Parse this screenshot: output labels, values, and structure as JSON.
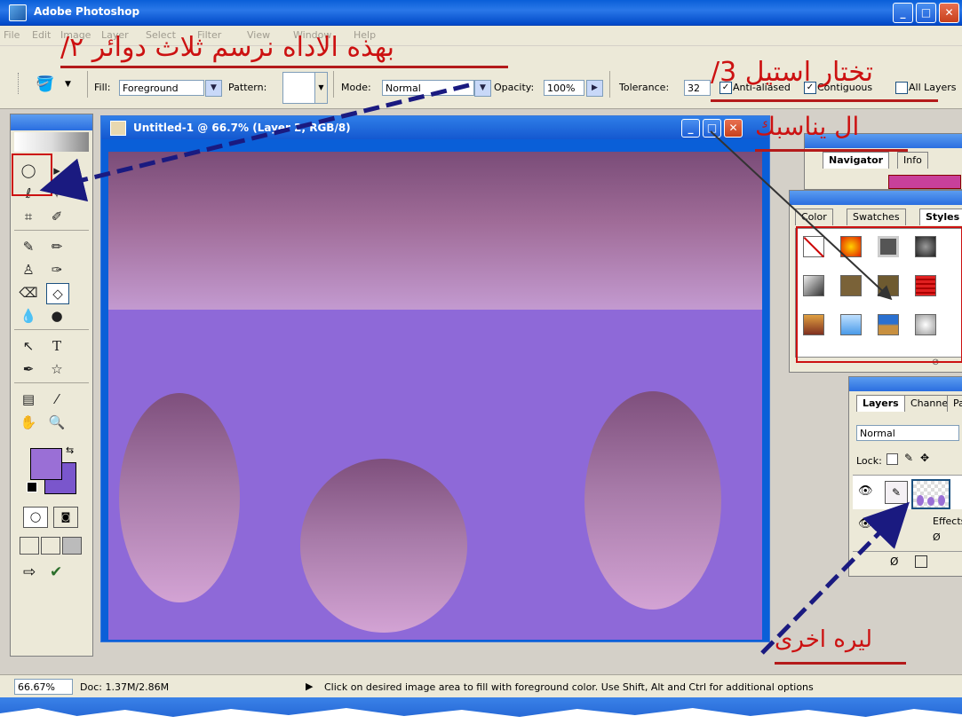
{
  "app": {
    "title": "Adobe Photoshop"
  },
  "menu": [
    "File",
    "Edit",
    "Image",
    "Layer",
    "Select",
    "Filter",
    "View",
    "Window",
    "Help"
  ],
  "options": {
    "fill_label": "Fill:",
    "fill_value": "Foreground",
    "pattern_label": "Pattern:",
    "mode_label": "Mode:",
    "mode_value": "Normal",
    "opacity_label": "Opacity:",
    "opacity_value": "100%",
    "tolerance_label": "Tolerance:",
    "tolerance_value": "32",
    "antialiased_label": "Anti-aliased",
    "contiguous_label": "Contiguous",
    "alllayers_label": "All Layers"
  },
  "document": {
    "title": "Untitled-1 @ 66.7% (Layer 2, RGB/8)"
  },
  "navigator": {
    "tabs": [
      "Navigator",
      "Info"
    ]
  },
  "styles_panel": {
    "tabs": [
      "Color",
      "Swatches",
      "Styles"
    ]
  },
  "layers_panel": {
    "tabs": [
      "Layers",
      "Channels",
      "Paths"
    ],
    "blend_mode": "Normal",
    "lock_label": "Lock:",
    "effects_label": "Effects"
  },
  "status": {
    "zoom": "66.67%",
    "doc": "Doc: 1.37M/2.86M",
    "hint": "Click on desired image area to fill with foreground color.  Use Shift, Alt and Ctrl for additional options"
  },
  "annotations": {
    "step1": "بهذه الاداه نرسم ثلاث دوائر ٢/",
    "step3_line1": "تختار استيل 3/",
    "step3_line2": "ال يناسبك",
    "step2": "ليره اخرى"
  },
  "colors": {
    "canvas": "#8e69d8",
    "foreground": "#9a6fd6",
    "background": "#7a56cc",
    "annotation": "#cc1111",
    "arrow": "#1a1a80"
  }
}
